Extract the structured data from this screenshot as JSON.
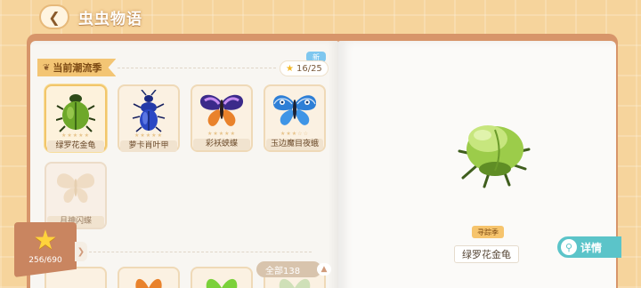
{
  "header": {
    "back_icon": "chevron-left-icon",
    "title": "虫虫物语"
  },
  "season": {
    "label": "当前潮流季",
    "progress": "16/25",
    "new_badge": "新"
  },
  "colors": {
    "accent": "#5bc4c9",
    "tag": "#f3c574",
    "book": "#d7956a"
  },
  "cards": [
    {
      "name": "绿罗花金龟",
      "stars": "★★★★★",
      "icon": "green-beetle-icon",
      "selected": true,
      "locked": false
    },
    {
      "name": "萝卡肖叶甲",
      "stars": "★★★★★",
      "icon": "blue-beetle-icon",
      "selected": false,
      "locked": false
    },
    {
      "name": "彩袄蛱蝶",
      "stars": "★★★★★",
      "icon": "purple-butterfly-icon",
      "selected": false,
      "locked": false
    },
    {
      "name": "玉边魔目夜蛾",
      "stars": "★★★☆☆",
      "icon": "blue-moth-icon",
      "selected": false,
      "locked": false
    },
    {
      "name": "月神闪蝶",
      "stars": "",
      "icon": "butterfly-silhouette-icon",
      "selected": false,
      "locked": true
    }
  ],
  "collection": {
    "total_label": "全部138",
    "count": "256/690"
  },
  "detail": {
    "season_chip": "寻踪季",
    "name": "绿罗花金龟",
    "button": "详情"
  }
}
